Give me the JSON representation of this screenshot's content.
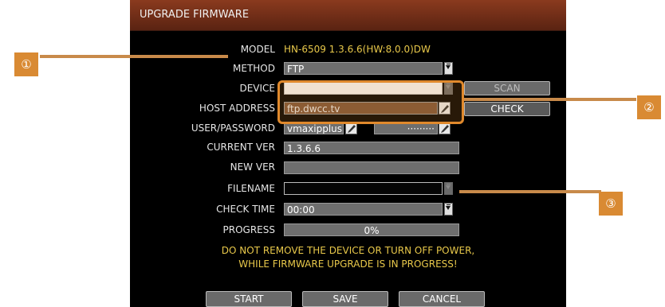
{
  "dialog": {
    "title": "UPGRADE FIRMWARE",
    "fields": {
      "model": {
        "label": "MODEL",
        "value": "HN-6509 1.3.6.6(HW:8.0.0)DW"
      },
      "method": {
        "label": "METHOD",
        "value": "FTP"
      },
      "device": {
        "label": "DEVICE",
        "value": ""
      },
      "host_address": {
        "label": "HOST ADDRESS",
        "value": "ftp.dwcc.tv"
      },
      "user_password": {
        "label": "USER/PASSWORD",
        "user": "vmaxipplus",
        "password": "·········"
      },
      "current_ver": {
        "label": "CURRENT VER",
        "value": "1.3.6.6"
      },
      "new_ver": {
        "label": "NEW VER",
        "value": ""
      },
      "filename": {
        "label": "FILENAME",
        "value": ""
      },
      "check_time": {
        "label": "CHECK TIME",
        "value": "00:00"
      },
      "progress": {
        "label": "PROGRESS",
        "value": "0%"
      }
    },
    "scan_label": "SCAN",
    "check_label": "CHECK",
    "warning_line1": "DO NOT REMOVE THE DEVICE OR TURN OFF POWER,",
    "warning_line2": "WHILE FIRMWARE UPGRADE IS IN PROGRESS!",
    "buttons": {
      "start": "START",
      "save": "SAVE",
      "cancel": "CANCEL"
    }
  },
  "callouts": {
    "one": "①",
    "two": "②",
    "three": "③"
  },
  "colors": {
    "accent": "#d98a33",
    "title_bar": "#7a3219",
    "value_yellow": "#e8c84a"
  }
}
